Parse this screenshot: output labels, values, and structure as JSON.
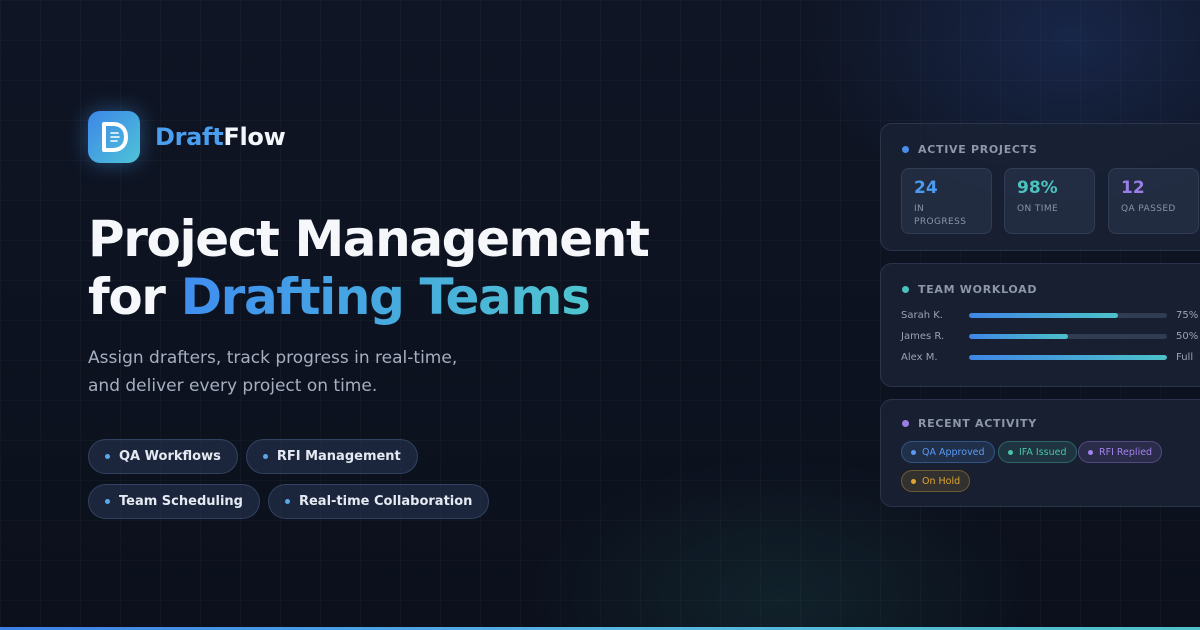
{
  "brand": {
    "name_part1": "Draft",
    "name_part2": "Flow",
    "logo_icon": "drafting-document-icon"
  },
  "hero": {
    "title_line1": "Project Management",
    "title_line2_plain": "for ",
    "title_line2_accent": "Drafting Teams",
    "subtitle_line1": "Assign drafters, track progress in real-time,",
    "subtitle_line2": "and deliver every project on time."
  },
  "tags": [
    "QA Workflows",
    "RFI Management",
    "Team Scheduling",
    "Real-time Collaboration"
  ],
  "active_projects": {
    "title": "ACTIVE PROJECTS",
    "dot_color": "#4a8ee8",
    "stats": [
      {
        "value": "24",
        "label_line1": "IN",
        "label_line2": "PROGRESS",
        "color": "#4b9bf0"
      },
      {
        "value": "98%",
        "label_line1": "ON TIME",
        "label_line2": "",
        "color": "#4cc2be"
      },
      {
        "value": "12",
        "label_line1": "QA PASSED",
        "label_line2": "",
        "color": "#9a7ee8"
      }
    ]
  },
  "team_workload": {
    "title": "TEAM WORKLOAD",
    "dot_color": "#4cc2be",
    "rows": [
      {
        "name": "Sarah K.",
        "pct_label": "75%",
        "fill": 0.75
      },
      {
        "name": "James R.",
        "pct_label": "50%",
        "fill": 0.5
      },
      {
        "name": "Alex M.",
        "pct_label": "Full",
        "fill": 1.0
      }
    ]
  },
  "recent_activity": {
    "title": "RECENT ACTIVITY",
    "dot_color": "#9a7ee8",
    "pills": [
      {
        "label": "QA Approved",
        "color": "#5a9af0"
      },
      {
        "label": "IFA Issued",
        "color": "#4cc2a8"
      },
      {
        "label": "RFI Replied",
        "color": "#a383ec"
      },
      {
        "label": "On Hold",
        "color": "#e0a630"
      }
    ]
  }
}
